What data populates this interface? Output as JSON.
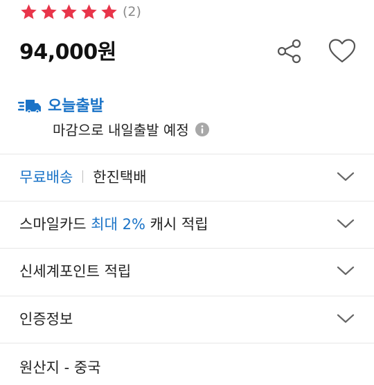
{
  "rating": {
    "stars": 5,
    "review_count": "(2)",
    "star_color": "#e8354a"
  },
  "price": {
    "text": "94,000원"
  },
  "actions": {
    "share_icon": "share-icon",
    "wishlist_icon": "heart-icon"
  },
  "delivery": {
    "title": "오늘출발",
    "note": "마감으로 내일출발 예정",
    "accent_color": "#1a73c7"
  },
  "rows": [
    {
      "id": "shipping",
      "highlight": "무료배송",
      "label": "한진택배"
    },
    {
      "id": "smile-card",
      "prefix": "스마일카드 ",
      "highlight": "최대 2%",
      "suffix": " 캐시 적립"
    },
    {
      "id": "shinsegae-point",
      "label": "신세계포인트 적립"
    },
    {
      "id": "certification",
      "label": "인증정보"
    },
    {
      "id": "origin",
      "label": "원산지 - 중국"
    }
  ]
}
